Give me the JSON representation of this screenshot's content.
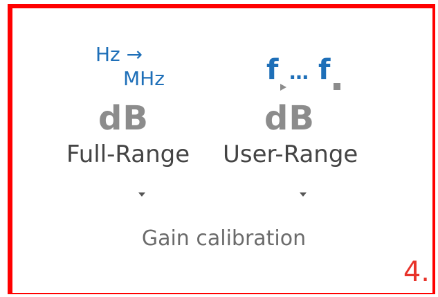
{
  "ribbon_group": {
    "label": "Gain calibration",
    "buttons": {
      "full_range": {
        "icon_from": "Hz →",
        "icon_to": "MHz",
        "icon_unit": "dB",
        "label": "Full-Range"
      },
      "user_range": {
        "icon_f1": "f",
        "icon_dots": "…",
        "icon_f2": "f",
        "icon_unit": "dB",
        "label": "User-Range"
      }
    }
  },
  "annotation": {
    "number": "4."
  },
  "colors": {
    "frame": "#ff0000",
    "icon_blue": "#1e6fb8",
    "icon_gray": "#8c8c8c",
    "annotation_red": "#e8332a"
  }
}
